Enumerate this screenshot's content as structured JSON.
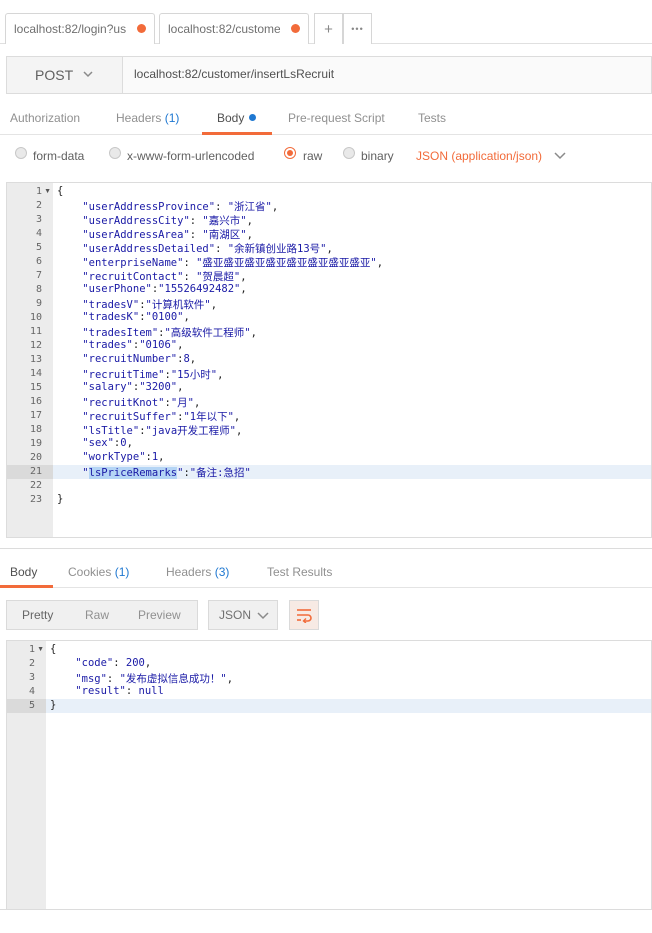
{
  "tabs": [
    {
      "label": "localhost:82/login?use"
    },
    {
      "label": "localhost:82/custome"
    }
  ],
  "tab_controls": {
    "add": "+",
    "more": "•••"
  },
  "request": {
    "method": "POST",
    "url": "localhost:82/customer/insertLsRecruit"
  },
  "subtabs": {
    "authorization": "Authorization",
    "headers": "Headers",
    "headers_count": "(1)",
    "body": "Body",
    "prerequest": "Pre-request Script",
    "tests": "Tests"
  },
  "body_types": {
    "form_data": "form-data",
    "urlencoded": "x-www-form-urlencoded",
    "raw": "raw",
    "binary": "binary",
    "selected": "raw",
    "format": "JSON (application/json)"
  },
  "request_body": {
    "line_numbers": [
      "1",
      "2",
      "3",
      "4",
      "5",
      "6",
      "7",
      "8",
      "9",
      "10",
      "11",
      "12",
      "13",
      "14",
      "15",
      "16",
      "17",
      "18",
      "19",
      "20",
      "21",
      "22",
      "23"
    ],
    "lines": [
      "{",
      "    \"userAddressProvince\": \"浙江省\",",
      "    \"userAddressCity\": \"嘉兴市\",",
      "    \"userAddressArea\": \"南湖区\",",
      "    \"userAddressDetailed\": \"余新镇创业路13号\",",
      "    \"enterpriseName\": \"盛亚盛亚盛亚盛亚盛亚盛亚盛亚盛亚\",",
      "    \"recruitContact\": \"贺晨超\",",
      "    \"userPhone\":\"15526492482\",",
      "    \"tradesV\":\"计算机软件\",",
      "    \"tradesK\":\"0100\",",
      "    \"tradesItem\":\"高级软件工程师\",",
      "    \"trades\":\"0106\",",
      "    \"recruitNumber\":8,",
      "    \"recruitTime\":\"15小时\",",
      "    \"salary\":\"3200\",",
      "    \"recruitKnot\":\"月\",",
      "    \"recruitSuffer\":\"1年以下\",",
      "    \"lsTitle\":\"java开发工程师\",",
      "    \"sex\":0,",
      "    \"workType\":1,",
      "    \"lsPriceRemarks\":\"备注:急招\"",
      "",
      "}"
    ]
  },
  "response_tabs": {
    "body": "Body",
    "cookies": "Cookies",
    "cookies_count": "(1)",
    "headers": "Headers",
    "headers_count": "(3)",
    "test_results": "Test Results"
  },
  "response_view": {
    "pretty": "Pretty",
    "raw": "Raw",
    "preview": "Preview",
    "format": "JSON"
  },
  "response_body": {
    "line_numbers": [
      "1",
      "2",
      "3",
      "4",
      "5"
    ],
    "lines": [
      "{",
      "    \"code\": 200,",
      "    \"msg\": \"发布虚拟信息成功！\",",
      "    \"result\": null",
      "}"
    ]
  },
  "colors": {
    "accent": "#f26b3a",
    "link": "#1f78d1",
    "code": "#1a1aa6"
  }
}
